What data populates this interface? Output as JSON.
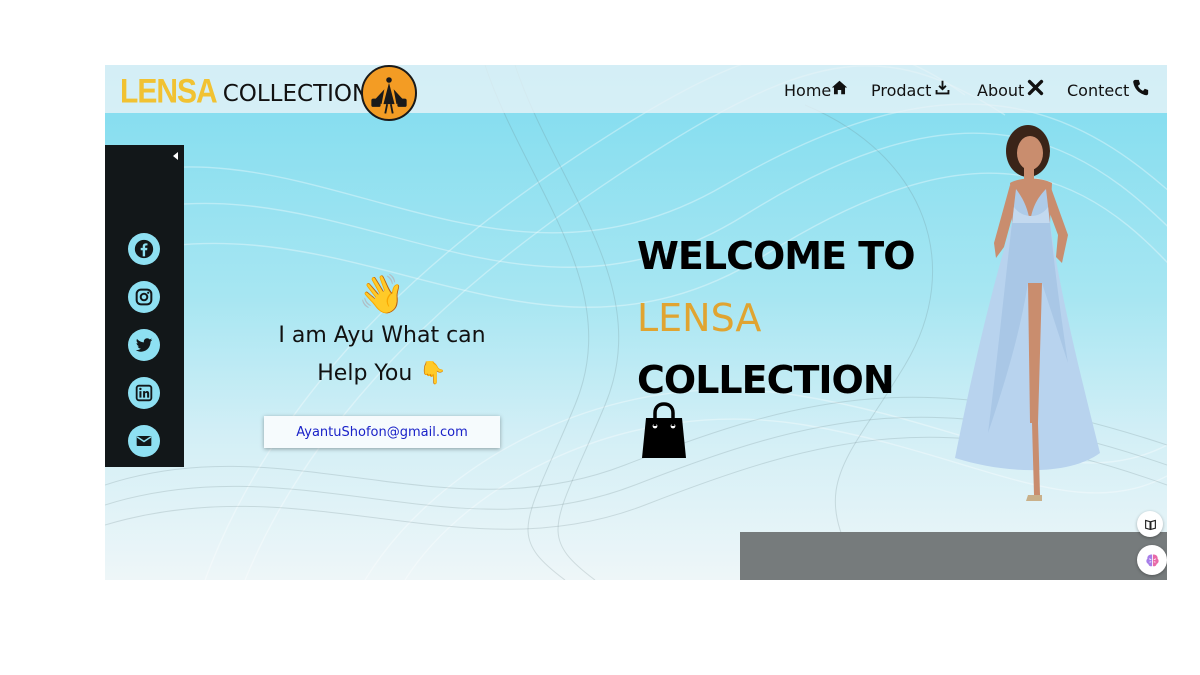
{
  "header": {
    "brand_highlight": "LENSA",
    "brand_rest": "COLLECTION",
    "nav": [
      {
        "label": "Home",
        "icon": "home-icon"
      },
      {
        "label": "Prodact",
        "icon": "download-icon"
      },
      {
        "label": "About",
        "icon": "x-icon"
      },
      {
        "label": "Contect",
        "icon": "phone-icon"
      }
    ]
  },
  "sidebar": {
    "socials": [
      "facebook-icon",
      "instagram-icon",
      "twitter-icon",
      "linkedin-icon",
      "mail-icon"
    ]
  },
  "chat": {
    "emoji": "👋",
    "line1": "I am Ayu What can",
    "line2": "Help You",
    "pointer_emoji": "👇",
    "email": "AyantuShofon@gmail.com"
  },
  "hero": {
    "line1": "WELCOME TO",
    "line2": "LENSA",
    "line3": "COLLECTION"
  },
  "colors": {
    "brand_yellow": "#f1c232",
    "lensa_gold": "#e0a431",
    "sidebar_bg": "#121719",
    "social_bg": "#8ee0f2",
    "email_text": "#1a22c8"
  }
}
